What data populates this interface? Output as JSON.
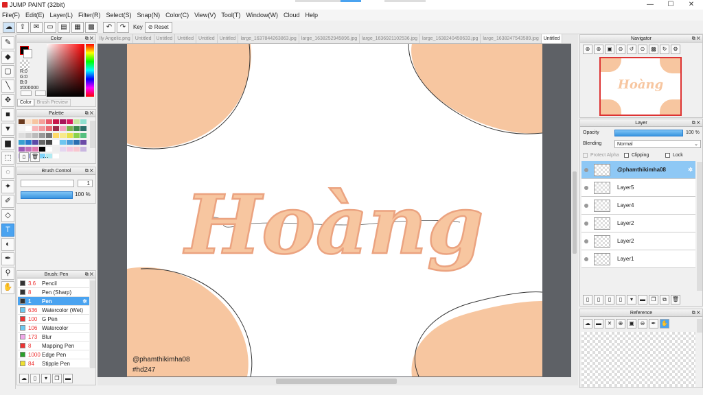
{
  "window": {
    "title": "JUMP PAINT (32bit)",
    "min": "—",
    "max": "☐",
    "close": "✕"
  },
  "menu": [
    "File(F)",
    "Edit(E)",
    "Layer(L)",
    "Filter(R)",
    "Select(S)",
    "Snap(N)",
    "Color(C)",
    "View(V)",
    "Tool(T)",
    "Window(W)",
    "Cloud",
    "Help"
  ],
  "toolbar": {
    "key_label": "Key",
    "reset_label": "Reset"
  },
  "tabs": [
    "lly Angelic.png",
    "Untitled",
    "Untitled",
    "Untitled",
    "Untitled",
    "Untitled",
    "large_1637844263863.jpg",
    "large_1638252945896.jpg",
    "large_1636921102536.jpg",
    "large_1638240450633.jpg",
    "large_1638247543589.jpg",
    "Untitled"
  ],
  "color_panel": {
    "title": "Color",
    "r": "R:0",
    "g": "G:0",
    "b": "B:0",
    "hex": "#000000",
    "tab_color": "Color",
    "tab_brush": "Brush Preview"
  },
  "palette": {
    "title": "Palette",
    "more": "···",
    "colors": [
      "#6b3b1f",
      "#fbe0c8",
      "#f7c5a0",
      "#f5a09a",
      "#e85a6a",
      "#c7154a",
      "#a8155a",
      "#d81b60",
      "#c7e7a0",
      "#8ee0d0",
      "#f5f5f5",
      "#ffffff",
      "#f8b5b8",
      "#f29a9e",
      "#e96b74",
      "#9c2a4a",
      "#f4a3c0",
      "#7ab34d",
      "#3a8a4a",
      "#2a6f6a",
      "#ddd",
      "#ccc",
      "#bbb",
      "#999",
      "#777",
      "#ffd966",
      "#f7e98a",
      "#e6e14a",
      "#8ad14a",
      "#53c07f",
      "#3aa0d0",
      "#2a7acd",
      "#5d4aa8",
      "#666",
      "#444",
      "#fff",
      "#6ec6f0",
      "#4a9bd8",
      "#2c6fb0",
      "#6b4aa8",
      "#9b59b6",
      "#c16fb8",
      "#e07ab0",
      "#000",
      "#fff",
      "#eee",
      "#e4d6f0",
      "#f5c8e0",
      "#f9c6cf",
      "#c9b6e0",
      "#b39ddb",
      "#9fa8da",
      "#90caf9",
      "#81d4fa",
      "#b2ebf2",
      "#fff"
    ]
  },
  "brush_control": {
    "title": "Brush Control",
    "size": "1",
    "opacity": "100 %"
  },
  "brushes": {
    "title": "Brush: Pen",
    "items": [
      {
        "size": "3.6",
        "name": "Pencil",
        "swatch": "#333"
      },
      {
        "size": "8",
        "name": "Pen (Sharp)",
        "swatch": "#333"
      },
      {
        "size": "1",
        "name": "Pen",
        "swatch": "#333",
        "selected": true
      },
      {
        "size": "636",
        "name": "Watercolor (Wet)",
        "swatch": "#6cc8f0"
      },
      {
        "size": "100",
        "name": "G Pen",
        "swatch": "#e33"
      },
      {
        "size": "106",
        "name": "Watercolor",
        "swatch": "#6cc8f0"
      },
      {
        "size": "173",
        "name": "Blur",
        "swatch": "#f0a8e8"
      },
      {
        "size": "8",
        "name": "Mapping Pen",
        "swatch": "#e33"
      },
      {
        "size": "1000",
        "name": "Edge Pen",
        "swatch": "#2aa02a"
      },
      {
        "size": "84",
        "name": "Stipple Pen",
        "swatch": "#f0e030"
      }
    ]
  },
  "navigator": {
    "title": "Navigator"
  },
  "layer_panel": {
    "title": "Layer",
    "opacity_label": "Opacity",
    "opacity_value": "100 %",
    "blending_label": "Blending",
    "blending_value": "Normal",
    "protect_alpha": "Protect Alpha",
    "clipping": "Clipping",
    "lock": "Lock"
  },
  "layers": [
    {
      "name": "@phamthikimha08",
      "selected": true
    },
    {
      "name": "Layer5"
    },
    {
      "name": "Layer4"
    },
    {
      "name": "Layer2"
    },
    {
      "name": "Layer2"
    },
    {
      "name": "Layer1"
    }
  ],
  "reference": {
    "title": "Reference"
  },
  "canvas": {
    "word": "Hoàng",
    "handle": "@phamthikimha08",
    "tag": "#hd247",
    "accent": "#f7c6a0"
  }
}
